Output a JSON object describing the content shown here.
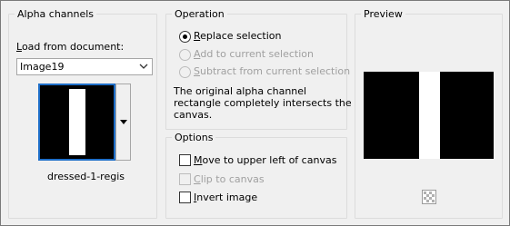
{
  "alpha_channels": {
    "title": "Alpha channels",
    "load_label_prefix": "L",
    "load_label_rest": "oad from document:",
    "document_value": "Image19",
    "channel_name": "dressed-1-regis"
  },
  "operation": {
    "title": "Operation",
    "replace": {
      "underlined": "R",
      "rest": "eplace selection",
      "selected": true
    },
    "add": {
      "underlined": "A",
      "rest": "dd to current selection",
      "enabled": false
    },
    "subtract": {
      "underlined": "S",
      "rest": "ubtract from current selection",
      "enabled": false
    },
    "message_line1": "The original alpha channel",
    "message_line2": "rectangle completely intersects the",
    "message_line3": "canvas."
  },
  "options": {
    "title": "Options",
    "move": {
      "underlined": "M",
      "rest": "ove to upper left of canvas",
      "checked": false
    },
    "clip": {
      "underlined": "C",
      "rest": "lip to canvas",
      "checked": false,
      "enabled": false
    },
    "invert": {
      "underlined": "I",
      "rest": "nvert image",
      "checked": false
    }
  },
  "preview": {
    "title": "Preview",
    "zoom_icon": "transparency-zoom-icon"
  }
}
